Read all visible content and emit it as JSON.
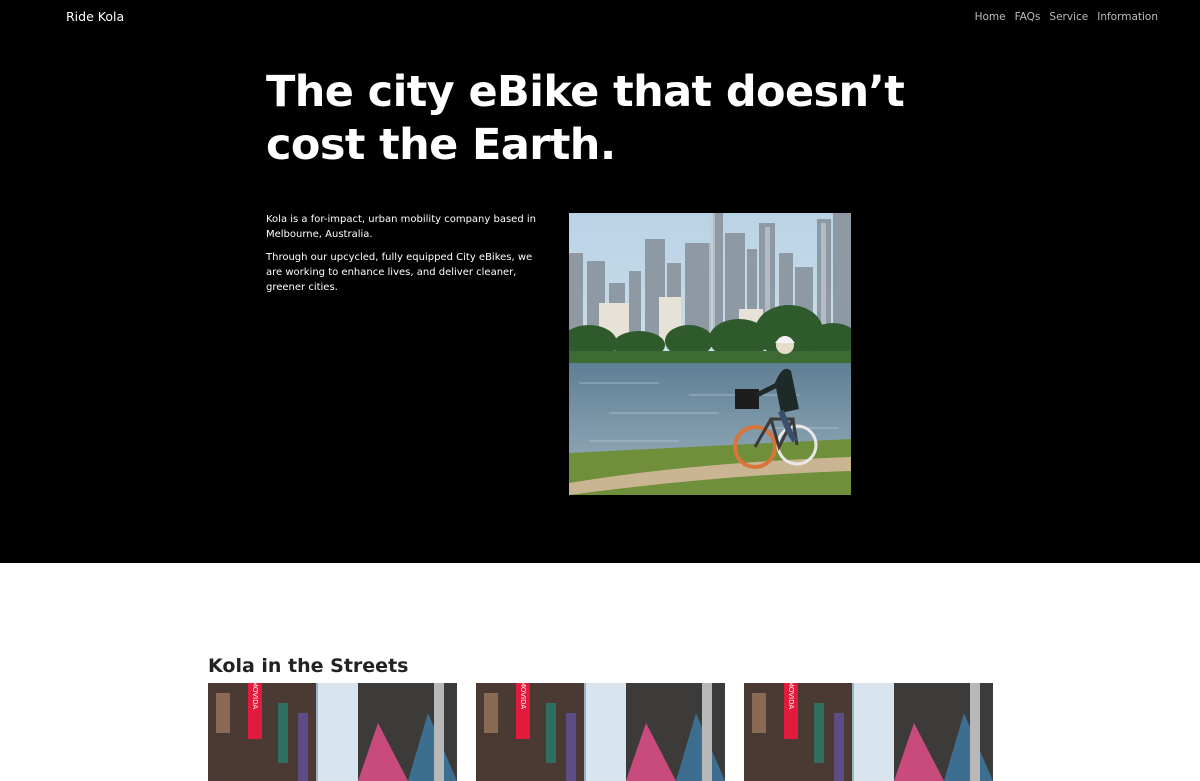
{
  "nav": {
    "brand": "Ride Kola",
    "links": [
      {
        "label": "Home"
      },
      {
        "label": "FAQs"
      },
      {
        "label": "Service"
      },
      {
        "label": "Information"
      }
    ]
  },
  "hero": {
    "title": "The city eBike that doesn’t cost the Earth.",
    "paragraphs": [
      "Kola is a for-impact, urban mobility company based in Melbourne, Australia.",
      "Through our upcycled, fully equipped City eBikes, we are working to enhance lives, and deliver cleaner, greener cities."
    ],
    "image_description": "cyclist-city-skyline-photo"
  },
  "streets": {
    "title": "Kola in the Streets",
    "images": [
      {
        "sign_text": "MOVIDA"
      },
      {
        "sign_text": "MOVIDA"
      },
      {
        "sign_text": "MOVIDA"
      }
    ]
  },
  "colors": {
    "hero_bg": "#000000",
    "page_bg": "#ffffff",
    "nav_link": "#bdbdbd",
    "frame_orange": "#d9743a"
  }
}
